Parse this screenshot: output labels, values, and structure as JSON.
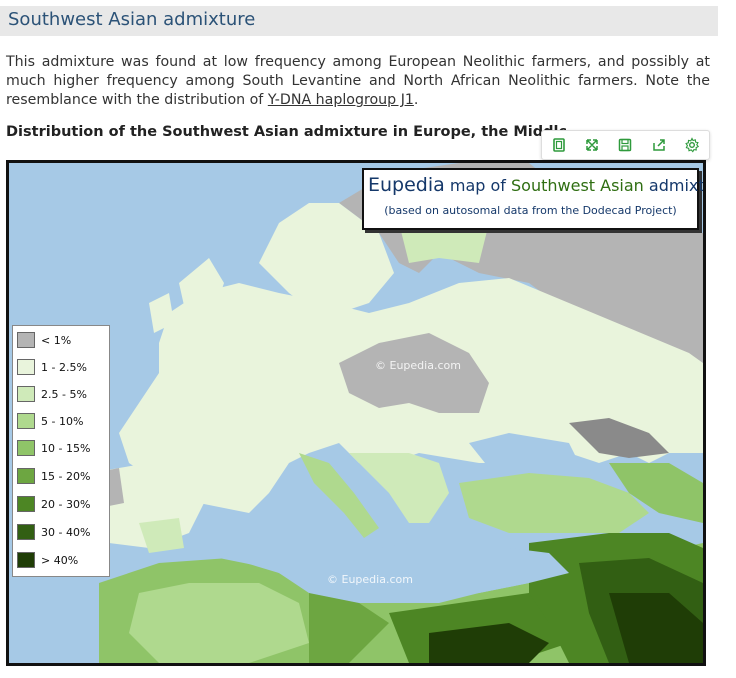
{
  "section": {
    "heading": "Southwest Asian admixture"
  },
  "intro": {
    "text_before": "This admixture was found at low frequency among European Neolithic farmers, and possibly at much higher frequency among South Levantine and North African Neolithic farmers. Note the resemblance with the distribution of ",
    "link": "Y-DNA haplogroup J1",
    "text_after": "."
  },
  "figure": {
    "caption": "Distribution of the Southwest Asian admixture in Europe, the Middle East and North Africa"
  },
  "toolbar": {
    "buttons": [
      {
        "icon": "book-page-icon"
      },
      {
        "icon": "expand-icon"
      },
      {
        "icon": "save-icon"
      },
      {
        "icon": "share-icon"
      },
      {
        "icon": "gear-icon"
      }
    ],
    "color": "#2e9a3c"
  },
  "map": {
    "title_brand": "Eupedia",
    "title_mid": " map of ",
    "title_subject": "Southwest Asian",
    "title_end": " admixture",
    "subtitle": "(based on autosomal data from the Dodecad Project)",
    "watermark_1": "© Eupedia.com",
    "watermark_2": "© Eupedia.com",
    "legend": [
      {
        "label": "< 1%",
        "color": "#b4b4b4"
      },
      {
        "label": "1 - 2.5%",
        "color": "#e9f4dc"
      },
      {
        "label": "2.5 - 5%",
        "color": "#cfeab9"
      },
      {
        "label": "5 - 10%",
        "color": "#afd98e"
      },
      {
        "label": "10 - 15%",
        "color": "#8fc468"
      },
      {
        "label": "15 - 20%",
        "color": "#6da641"
      },
      {
        "label": "20 - 30%",
        "color": "#4d8624"
      },
      {
        "label": "30 - 40%",
        "color": "#325f13"
      },
      {
        "label": "> 40%",
        "color": "#1f3d06"
      }
    ],
    "sea_color": "#a6c9e6"
  }
}
